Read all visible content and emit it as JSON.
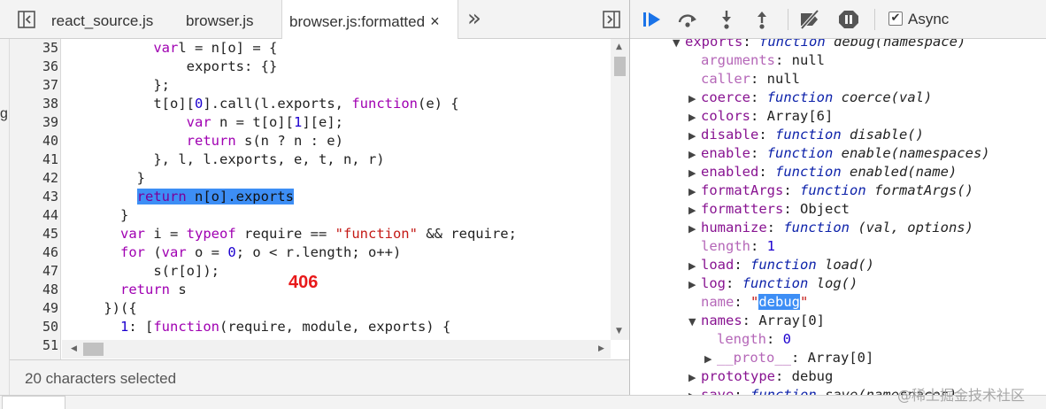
{
  "tabs": {
    "items": [
      {
        "label": "react_source.js"
      },
      {
        "label": "browser.js"
      },
      {
        "label": "browser.js:formatted",
        "active": true
      }
    ],
    "close_glyph": "×",
    "more_glyph": "»"
  },
  "editor": {
    "lines": [
      {
        "n": "35",
        "indent": 10,
        "parts": [
          [
            "kw",
            "var"
          ],
          [
            "",
            "l = n[o] = {"
          ]
        ]
      },
      {
        "n": "36",
        "indent": 14,
        "parts": [
          [
            "",
            "exports: {}"
          ]
        ]
      },
      {
        "n": "37",
        "indent": 10,
        "parts": [
          [
            "",
            "};"
          ]
        ]
      },
      {
        "n": "38",
        "indent": 10,
        "parts": [
          [
            "",
            "t[o]["
          ],
          [
            "num",
            "0"
          ],
          [
            "",
            "].call(l.exports, "
          ],
          [
            "kw",
            "function"
          ],
          [
            "",
            "(e) {"
          ]
        ]
      },
      {
        "n": "39",
        "indent": 14,
        "parts": [
          [
            "kw",
            "var"
          ],
          [
            "",
            " n = t[o]["
          ],
          [
            "num",
            "1"
          ],
          [
            "",
            "][e];"
          ]
        ]
      },
      {
        "n": "40",
        "indent": 14,
        "parts": [
          [
            "kw",
            "return"
          ],
          [
            "",
            " s(n ? n : e)"
          ]
        ]
      },
      {
        "n": "41",
        "indent": 10,
        "parts": [
          [
            "",
            "}, l, l.exports, e, t, n, r)"
          ]
        ]
      },
      {
        "n": "42",
        "indent": 8,
        "parts": [
          [
            "",
            "}"
          ]
        ]
      },
      {
        "n": "43",
        "indent": 8,
        "highlight": true,
        "parts": [
          [
            "",
            ""
          ],
          [
            "kw",
            "return"
          ],
          [
            "",
            " n[o].exports"
          ]
        ]
      },
      {
        "n": "44",
        "indent": 6,
        "parts": [
          [
            "",
            "}"
          ]
        ]
      },
      {
        "n": "45",
        "indent": 6,
        "parts": [
          [
            "kw",
            "var"
          ],
          [
            "",
            " i = "
          ],
          [
            "kw",
            "typeof"
          ],
          [
            "",
            " require == "
          ],
          [
            "str",
            "\"function\""
          ],
          [
            "",
            " && require;"
          ]
        ]
      },
      {
        "n": "46",
        "indent": 6,
        "parts": [
          [
            "kw",
            "for"
          ],
          [
            "",
            " ("
          ],
          [
            "kw",
            "var"
          ],
          [
            "",
            " o = "
          ],
          [
            "num",
            "0"
          ],
          [
            "",
            "; o < r.length; o++)"
          ]
        ]
      },
      {
        "n": "47",
        "indent": 10,
        "parts": [
          [
            "",
            "s(r[o]);"
          ]
        ]
      },
      {
        "n": "48",
        "indent": 6,
        "parts": [
          [
            "kw",
            "return"
          ],
          [
            "",
            " s"
          ]
        ]
      },
      {
        "n": "49",
        "indent": 4,
        "parts": [
          [
            "",
            "})({"
          ]
        ]
      },
      {
        "n": "50",
        "indent": 6,
        "parts": [
          [
            "num",
            "1"
          ],
          [
            "",
            ": ["
          ],
          [
            "kw",
            "function"
          ],
          [
            "",
            "(require, module, exports) {"
          ]
        ]
      },
      {
        "n": "51",
        "indent": 0,
        "parts": [
          [
            "",
            ""
          ]
        ]
      }
    ],
    "annotation": "406",
    "edge_char": "g"
  },
  "status": {
    "text": "20 characters selected"
  },
  "debugger": {
    "async_label": "Async",
    "async_checked": "✔",
    "buttons": [
      "resume-icon",
      "step-over-icon",
      "step-into-icon",
      "step-out-icon",
      "deactivate-breakpoints-icon",
      "pause-on-exceptions-icon"
    ]
  },
  "scope": {
    "rows": [
      {
        "indent": 0,
        "tri": "▼",
        "key": "exports",
        "kdim": false,
        "parts": [
          [
            "fnkw",
            "function"
          ],
          [
            "fnsig",
            " debug(namespace)"
          ]
        ]
      },
      {
        "indent": 1,
        "tri": "",
        "key": "arguments",
        "kdim": true,
        "parts": [
          [
            "val",
            "null"
          ]
        ]
      },
      {
        "indent": 1,
        "tri": "",
        "key": "caller",
        "kdim": true,
        "parts": [
          [
            "val",
            "null"
          ]
        ]
      },
      {
        "indent": 1,
        "tri": "▶",
        "key": "coerce",
        "kdim": false,
        "parts": [
          [
            "fnkw",
            "function"
          ],
          [
            "fnsig",
            " coerce(val)"
          ]
        ]
      },
      {
        "indent": 1,
        "tri": "▶",
        "key": "colors",
        "kdim": false,
        "parts": [
          [
            "val",
            "Array[6]"
          ]
        ]
      },
      {
        "indent": 1,
        "tri": "▶",
        "key": "disable",
        "kdim": false,
        "parts": [
          [
            "fnkw",
            "function"
          ],
          [
            "fnsig",
            " disable()"
          ]
        ]
      },
      {
        "indent": 1,
        "tri": "▶",
        "key": "enable",
        "kdim": false,
        "parts": [
          [
            "fnkw",
            "function"
          ],
          [
            "fnsig",
            " enable(namespaces)"
          ]
        ]
      },
      {
        "indent": 1,
        "tri": "▶",
        "key": "enabled",
        "kdim": false,
        "parts": [
          [
            "fnkw",
            "function"
          ],
          [
            "fnsig",
            " enabled(name)"
          ]
        ]
      },
      {
        "indent": 1,
        "tri": "▶",
        "key": "formatArgs",
        "kdim": false,
        "parts": [
          [
            "fnkw",
            "function"
          ],
          [
            "fnsig",
            " formatArgs()"
          ]
        ]
      },
      {
        "indent": 1,
        "tri": "▶",
        "key": "formatters",
        "kdim": false,
        "parts": [
          [
            "val",
            "Object"
          ]
        ]
      },
      {
        "indent": 1,
        "tri": "▶",
        "key": "humanize",
        "kdim": false,
        "parts": [
          [
            "fnkw",
            "function"
          ],
          [
            "fnsig",
            " (val, options)"
          ]
        ]
      },
      {
        "indent": 1,
        "tri": "",
        "key": "length",
        "kdim": true,
        "parts": [
          [
            "vnum",
            "1"
          ]
        ]
      },
      {
        "indent": 1,
        "tri": "▶",
        "key": "load",
        "kdim": false,
        "parts": [
          [
            "fnkw",
            "function"
          ],
          [
            "fnsig",
            " load()"
          ]
        ]
      },
      {
        "indent": 1,
        "tri": "▶",
        "key": "log",
        "kdim": false,
        "parts": [
          [
            "fnkw",
            "function"
          ],
          [
            "fnsig",
            " log()"
          ]
        ]
      },
      {
        "indent": 1,
        "tri": "",
        "key": "name",
        "kdim": true,
        "parts": [
          [
            "vstr",
            "\""
          ],
          [
            "vsel",
            "debug"
          ],
          [
            "vstr",
            "\""
          ]
        ]
      },
      {
        "indent": 1,
        "tri": "▼",
        "key": "names",
        "kdim": false,
        "parts": [
          [
            "val",
            "Array[0]"
          ]
        ]
      },
      {
        "indent": 2,
        "tri": "",
        "key": "length",
        "kdim": true,
        "parts": [
          [
            "vnum",
            "0"
          ]
        ]
      },
      {
        "indent": 2,
        "tri": "▶",
        "key": "__proto__",
        "kdim": true,
        "parts": [
          [
            "val",
            "Array[0]"
          ]
        ]
      },
      {
        "indent": 1,
        "tri": "▶",
        "key": "prototype",
        "kdim": false,
        "parts": [
          [
            "val",
            "debug"
          ]
        ]
      },
      {
        "indent": 1,
        "tri": "▶",
        "key": "save",
        "kdim": false,
        "parts": [
          [
            "fnkw",
            "function"
          ],
          [
            "fnsig",
            " save(namespaces)"
          ]
        ]
      }
    ]
  },
  "watermark": "@稀土掘金技术社区",
  "colors": {
    "accent": "#3d8ef5",
    "keyword": "#a000b2",
    "string": "#c41a16",
    "number": "#1c00cf",
    "annotation": "#e8191a"
  }
}
